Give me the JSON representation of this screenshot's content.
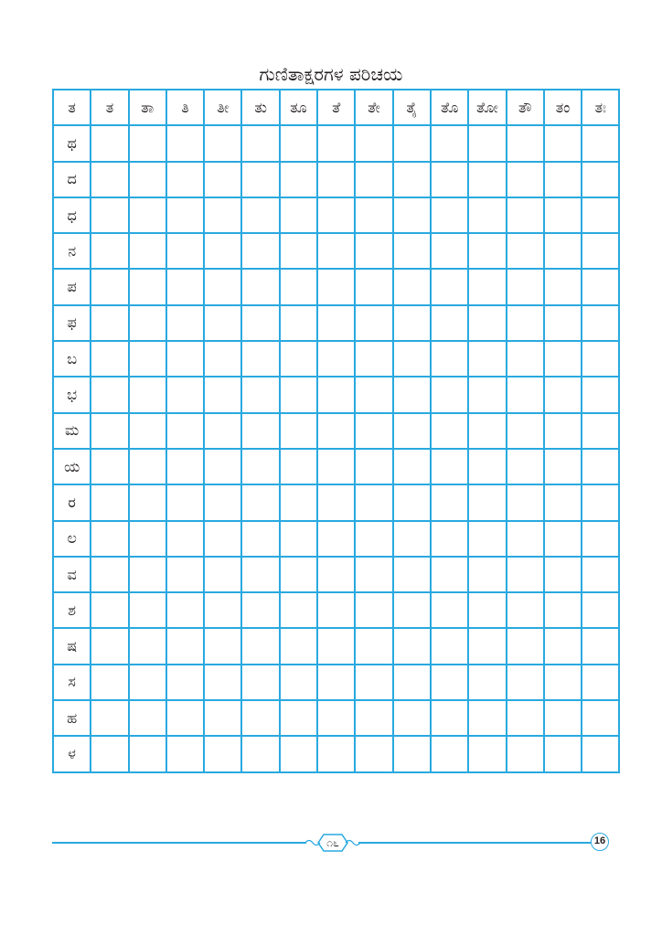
{
  "title": "ಗುಣಿತಾಕ್ಷರಗಳ ಪರಿಚಯ",
  "grid": {
    "header": [
      "ತ",
      "ತ",
      "ತಾ",
      "ತಿ",
      "ತೀ",
      "ತು",
      "ತೂ",
      "ತೆ",
      "ತೇ",
      "ತೈ",
      "ತೊ",
      "ತೋ",
      "ತೌ",
      "ತಂ",
      "ತಃ"
    ],
    "rows": [
      "ಥ",
      "ದ",
      "ಧ",
      "ನ",
      "ಪ",
      "ಫ",
      "ಬ",
      "ಭ",
      "ಮ",
      "ಯ",
      "ರ",
      "ಲ",
      "ವ",
      "ಶ",
      "ಷ",
      "ಸ",
      "ಹ",
      "ಳ"
    ],
    "blank_columns": 14
  },
  "footer": {
    "ornament_text": "೧೬",
    "page_number": "16"
  },
  "colors": {
    "grid_line": "#29a9e0",
    "text": "#231f20",
    "background": "#ffffff"
  }
}
